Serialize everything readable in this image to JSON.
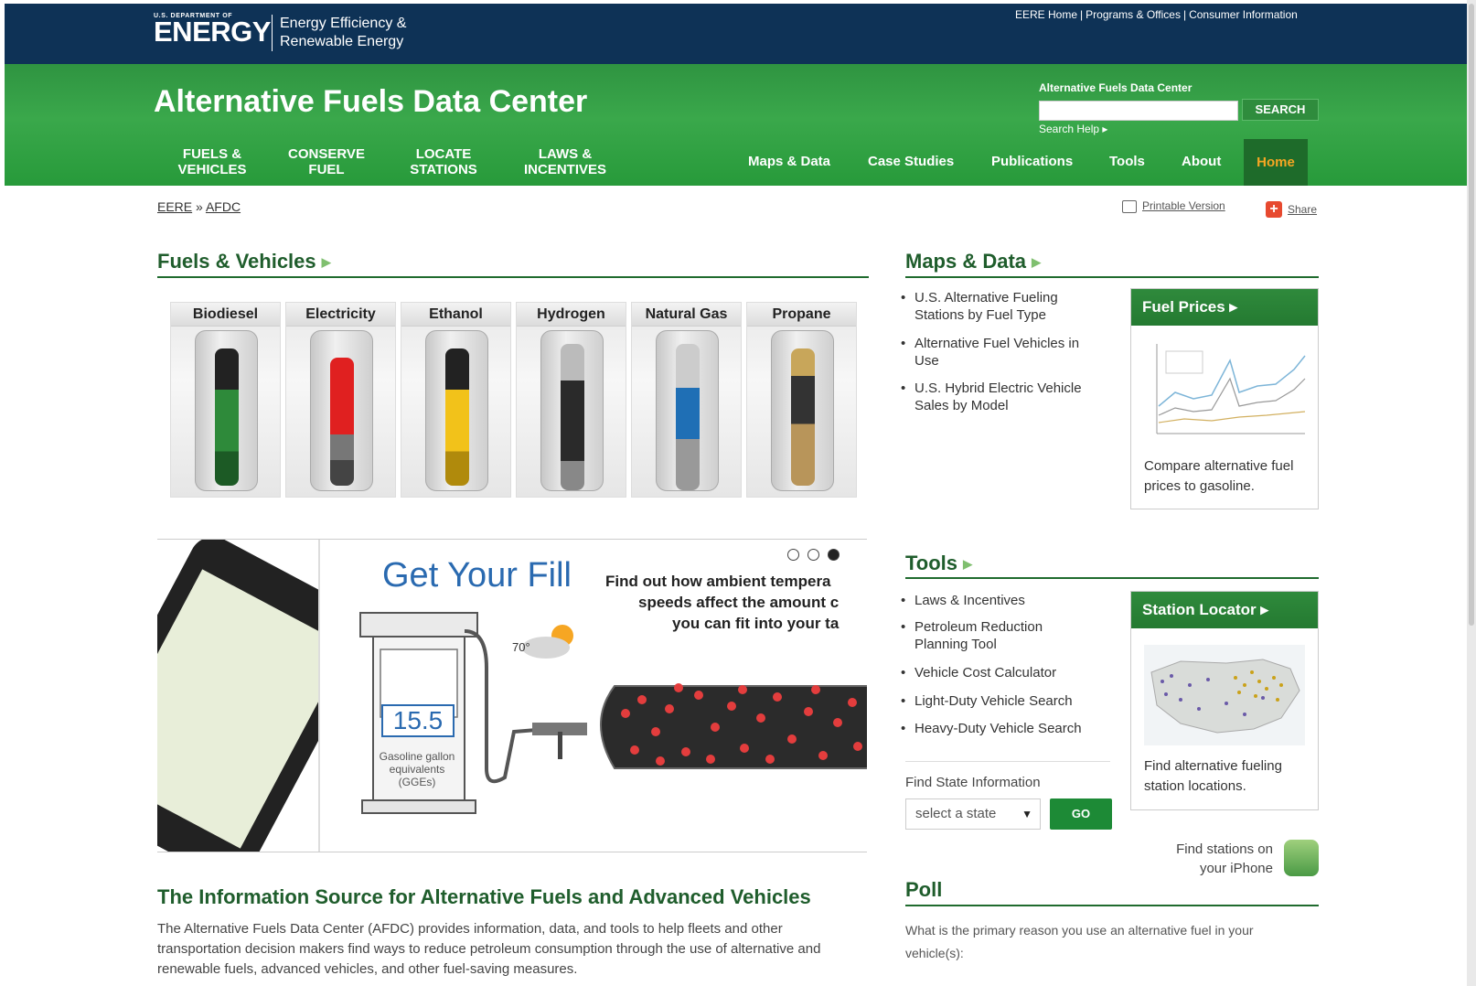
{
  "header": {
    "agency_small": "U.S. DEPARTMENT OF",
    "agency_big": "ENERGY",
    "office_line1": "Energy Efficiency &",
    "office_line2": "Renewable Energy",
    "top_links": [
      "EERE Home",
      "Programs & Offices",
      "Consumer Information"
    ]
  },
  "site": {
    "title": "Alternative Fuels Data Center",
    "search_label": "Alternative Fuels Data Center",
    "search_value": "",
    "search_button": "SEARCH",
    "search_help": "Search Help ▸"
  },
  "main_nav": [
    {
      "line1": "FUELS &",
      "line2": "VEHICLES"
    },
    {
      "line1": "CONSERVE",
      "line2": "FUEL"
    },
    {
      "line1": "LOCATE",
      "line2": "STATIONS"
    },
    {
      "line1": "LAWS &",
      "line2": "INCENTIVES"
    }
  ],
  "secondary_nav": [
    "Maps & Data",
    "Case Studies",
    "Publications",
    "Tools",
    "About",
    "Home"
  ],
  "breadcrumb": {
    "root": "EERE",
    "sep": "»",
    "current": "AFDC"
  },
  "page_tools": {
    "print": "Printable Version",
    "share": "Share"
  },
  "fuels_section": {
    "heading": "Fuels & Vehicles",
    "fuels": [
      "Biodiesel",
      "Electricity",
      "Ethanol",
      "Hydrogen",
      "Natural Gas",
      "Propane"
    ]
  },
  "slideshow": {
    "title": "Get Your Fill",
    "text_lines": [
      "Find out how ambient tempera",
      "speeds affect the amount c",
      "you can fit into your ta"
    ],
    "temperature": "70°",
    "gauge_value": "15.5",
    "gauge_caption": [
      "Gasoline gallon",
      "equivalents",
      "(GGEs)"
    ],
    "active_slide": 3,
    "slide_count": 3
  },
  "intro": {
    "heading": "The Information Source for Alternative Fuels and Advanced Vehicles",
    "body": "The Alternative Fuels Data Center (AFDC) provides information, data, and tools to help fleets and other transportation decision makers find ways to reduce petroleum consumption through the use of alternative and renewable fuels, advanced vehicles, and other fuel-saving measures."
  },
  "maps_section": {
    "heading": "Maps & Data",
    "links": [
      [
        "U.S. Alternative Fueling",
        "Stations by Fuel Type"
      ],
      [
        "Alternative Fuel Vehicles in",
        "Use"
      ],
      [
        "U.S. Hybrid Electric Vehicle",
        "Sales by Model"
      ]
    ],
    "card_title": "Fuel Prices ▸",
    "card_text": [
      "Compare alternative fuel",
      "prices to gasoline."
    ]
  },
  "tools_section": {
    "heading": "Tools",
    "links": [
      [
        "Laws & Incentives"
      ],
      [
        "Petroleum Reduction",
        "Planning Tool"
      ],
      [
        "Vehicle Cost Calculator"
      ],
      [
        "Light-Duty Vehicle Search"
      ],
      [
        "Heavy-Duty Vehicle Search"
      ]
    ],
    "card_title": "Station Locator ▸",
    "card_text": [
      "Find alternative fueling",
      "station locations."
    ],
    "state_label": "Find State Information",
    "state_select": "select a state",
    "go_button": "GO",
    "iphone_text": [
      "Find stations on",
      "your iPhone"
    ]
  },
  "poll": {
    "heading": "Poll",
    "question": "What is the primary reason you use an alternative fuel in your vehicle(s):"
  },
  "colors": {
    "navy": "#0e3256",
    "green": "#3aa84b",
    "dark_green": "#1f5d2c",
    "home_orange": "#f6a623"
  }
}
